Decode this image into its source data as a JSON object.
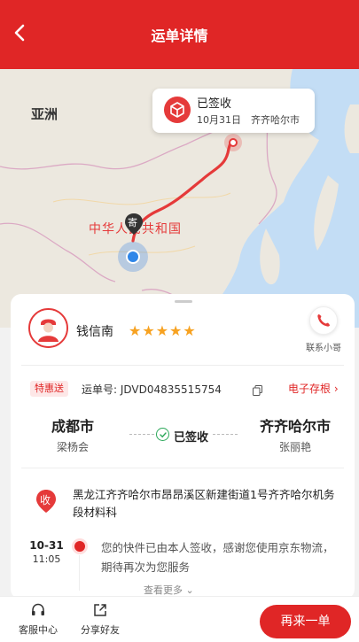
{
  "header": {
    "title": "运单详情",
    "back_icon": "chevron-left-icon"
  },
  "map": {
    "labels": {
      "asia": "亚洲",
      "china": "中华人民共和国"
    },
    "popup": {
      "status": "已签收",
      "date": "10月31日",
      "city": "齐齐哈尔市",
      "icon": "package-icon"
    },
    "sender_pin_label": "寄"
  },
  "courier": {
    "name": "钱信南",
    "rating": "★★★★★",
    "contact_label": "联系小哥"
  },
  "shipment": {
    "badge": "特惠送",
    "waybill_label": "运单号: JDVD04835515754",
    "receipt_label": "电子存根",
    "from_city": "成都市",
    "from_name": "梁杨会",
    "status": "已签收",
    "to_city": "齐齐哈尔市",
    "to_name": "张丽艳",
    "address_icon_label": "收",
    "address": "黑龙江齐齐哈尔市昂昂溪区新建街道1号齐齐哈尔机务段材料科"
  },
  "timeline": {
    "date": "10-31",
    "time": "11:05",
    "text": "您的快件已由本人签收，感谢您使用京东物流，期待再次为您服务",
    "more_label": "查看更多"
  },
  "bottom_bar": {
    "service_label": "客服中心",
    "share_label": "分享好友",
    "again_label": "再来一单"
  },
  "colors": {
    "brand_red": "#e02626",
    "star": "#f7a221",
    "check_green": "#2ca85a"
  }
}
